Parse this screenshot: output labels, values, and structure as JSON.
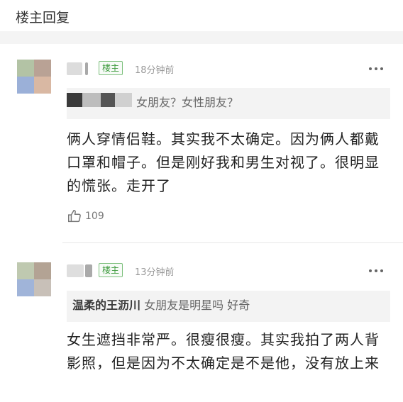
{
  "page": {
    "title": "楼主回复"
  },
  "comments": [
    {
      "badge": "楼主",
      "time": "18分钟前",
      "quote": {
        "user": "",
        "text": "女朋友？女性朋友？"
      },
      "text": "俩人穿情侣鞋。其实我不太确定。因为俩人都戴口罩和帽子。但是刚好我和男生对视了。很明显的慌张。走开了",
      "likes": "109"
    },
    {
      "badge": "楼主",
      "time": "13分钟前",
      "quote": {
        "user": "温柔的王沥川",
        "text": "女朋友是明星吗 好奇"
      },
      "text": "女生遮挡非常严。很瘦很瘦。其实我拍了两人背影照，但是因为不太确定是不是他，没有放上来"
    }
  ],
  "colors": {
    "badge": "#3d9a3d",
    "meta": "#999999",
    "quote_bg": "#f3f3f3"
  },
  "icons": {
    "like": "thumbs-up-icon",
    "more": "more-dots-icon"
  }
}
